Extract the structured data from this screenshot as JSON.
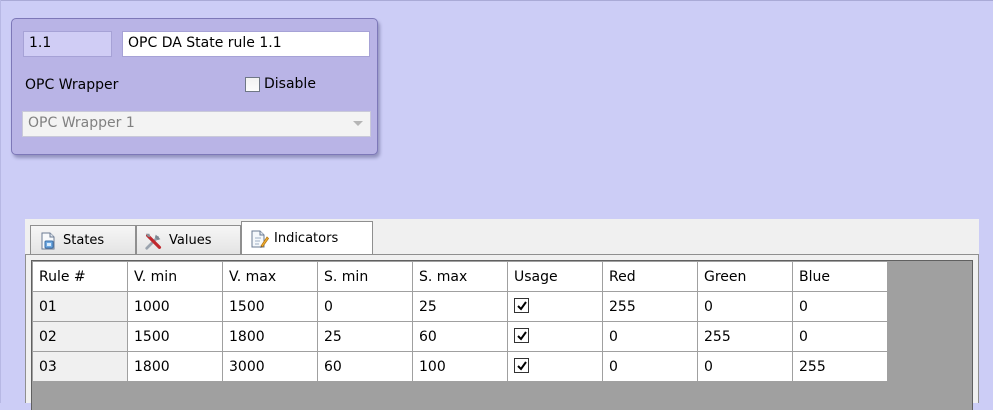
{
  "object": {
    "id": "1.1",
    "name": "OPC DA State rule 1.1",
    "wrapper_label": "OPC Wrapper",
    "disable_label": "Disable",
    "disable_checked": false,
    "wrapper_select_value": "OPC Wrapper 1"
  },
  "tabs": [
    {
      "label": "States",
      "icon": "states-icon"
    },
    {
      "label": "Values",
      "icon": "tools-icon"
    },
    {
      "label": "Indicators",
      "icon": "indicators-icon",
      "active": true
    }
  ],
  "grid": {
    "columns": [
      "Rule #",
      "V. min",
      "V. max",
      "S. min",
      "S. max",
      "Usage",
      "Red",
      "Green",
      "Blue"
    ],
    "rows": [
      {
        "rule": "01",
        "vmin": "1000",
        "vmax": "1500",
        "smin": "0",
        "smax": "25",
        "usage": true,
        "red": "255",
        "green": "0",
        "blue": "0"
      },
      {
        "rule": "02",
        "vmin": "1500",
        "vmax": "1800",
        "smin": "25",
        "smax": "60",
        "usage": true,
        "red": "0",
        "green": "255",
        "blue": "0"
      },
      {
        "rule": "03",
        "vmin": "1800",
        "vmax": "3000",
        "smin": "60",
        "smax": "100",
        "usage": true,
        "red": "0",
        "green": "0",
        "blue": "255"
      }
    ]
  },
  "colors": {
    "background": "#cccdf6",
    "panel": "#b9b4e6",
    "grid_empty": "#a0a0a0"
  }
}
